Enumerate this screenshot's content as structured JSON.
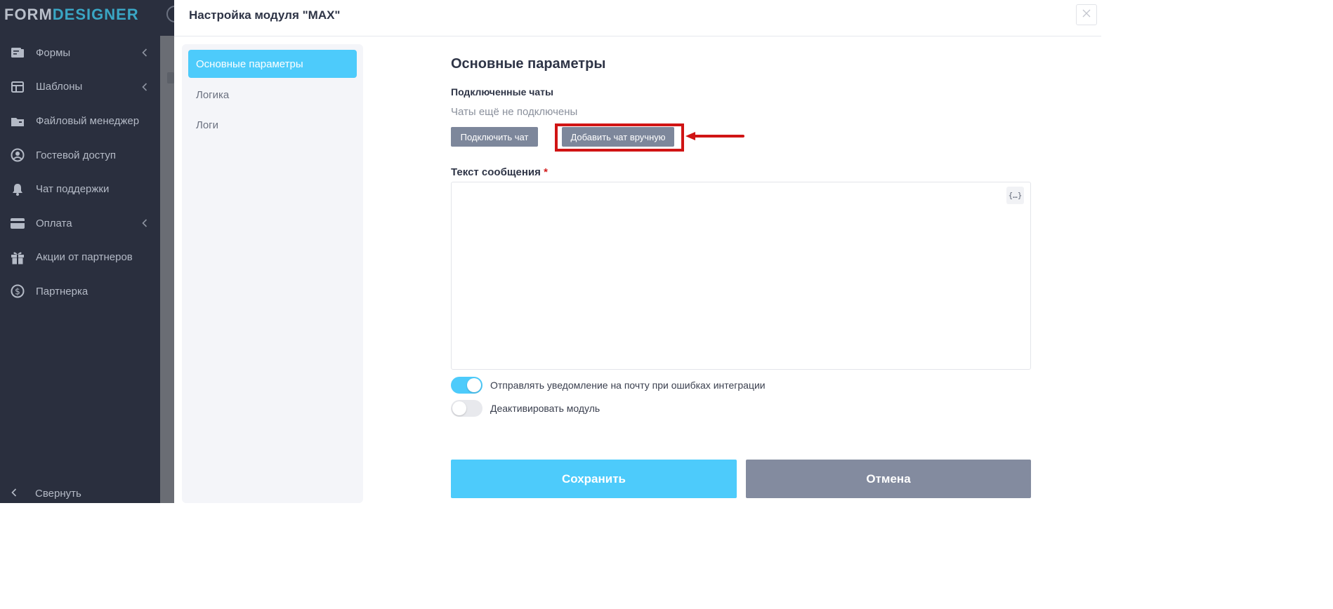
{
  "app": {
    "logo_part1": "FORM",
    "logo_part2": "DESIGNER"
  },
  "sidebar": {
    "items": [
      {
        "label": "Формы",
        "icon": "forms-icon",
        "has_chevron": true
      },
      {
        "label": "Шаблоны",
        "icon": "templates-icon",
        "has_chevron": true
      },
      {
        "label": "Файловый менеджер",
        "icon": "folder-icon",
        "has_chevron": false
      },
      {
        "label": "Гостевой доступ",
        "icon": "user-circle-icon",
        "has_chevron": false
      },
      {
        "label": "Чат поддержки",
        "icon": "bell-icon",
        "has_chevron": false
      },
      {
        "label": "Оплата",
        "icon": "credit-card-icon",
        "has_chevron": true
      },
      {
        "label": "Акции от партнеров",
        "icon": "gift-icon",
        "has_chevron": false
      },
      {
        "label": "Партнерка",
        "icon": "dollar-circle-icon",
        "has_chevron": false
      }
    ],
    "collapse_label": "Свернуть"
  },
  "modal": {
    "title": "Настройка модуля \"MAX\"",
    "tabs": [
      {
        "label": "Основные параметры",
        "active": true
      },
      {
        "label": "Логика",
        "active": false
      },
      {
        "label": "Логи",
        "active": false
      }
    ]
  },
  "main": {
    "heading": "Основные параметры",
    "connected_chats_label": "Подключенные чаты",
    "no_chats_text": "Чаты ещё не подключены",
    "connect_chat_button": "Подключить чат",
    "add_chat_manual_button": "Добавить чат вручную",
    "message_label": "Текст сообщения",
    "required_mark": "*",
    "message_value": "",
    "variables_button": "{…}",
    "toggles": [
      {
        "label": "Отправлять уведомление на почту при ошибках интеграции",
        "on": true
      },
      {
        "label": "Деактивировать модуль",
        "on": false
      }
    ],
    "save_button": "Сохранить",
    "cancel_button": "Отмена"
  },
  "colors": {
    "accent": "#4dcbfb",
    "sidebar_bg": "#2a2f3e",
    "secondary_button": "#838b9f",
    "highlight_annotation": "#d01414"
  }
}
